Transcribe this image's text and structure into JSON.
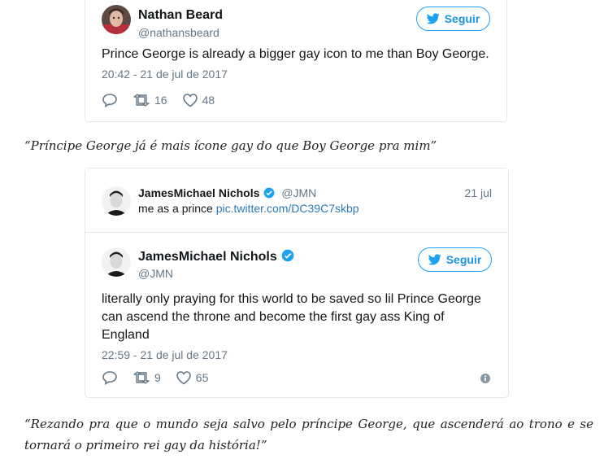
{
  "tweet1": {
    "name": "Nathan Beard",
    "handle": "@nathansbeard",
    "follow_label": "Seguir",
    "text": "Prince George is already a bigger gay icon to me than Boy George.",
    "timestamp": "20:42 - 21 de jul de 2017",
    "retweets": "16",
    "likes": "48"
  },
  "quote1": "“Príncipe George já é mais ícone gay do que Boy George pra mim”",
  "tweet2": {
    "quoted": {
      "name": "JamesMichael Nichols",
      "handle": "@JMN",
      "date": "21 jul",
      "text_prefix": "me as a prince",
      "link": "pic.twitter.com/DC39C7skbp"
    },
    "name": "JamesMichael Nichols",
    "handle": "@JMN",
    "follow_label": "Seguir",
    "text": "literally only praying for this world to be saved so lil Prince George can ascend the throne and become the first gay ass King of England",
    "timestamp": "22:59 - 21 de jul de 2017",
    "retweets": "9",
    "likes": "65"
  },
  "quote2": "“Rezando pra que o mundo seja salvo pelo príncipe George, que ascenderá ao trono e se tornará o primeiro rei gay da história!”",
  "colors": {
    "twitter_blue": "#1da1f2",
    "verified": "#1da1f2",
    "muted": "#657786",
    "border": "#e1e8ed"
  }
}
